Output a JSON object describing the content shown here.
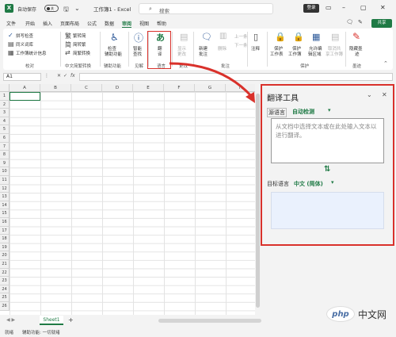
{
  "titlebar": {
    "logo": "X",
    "autosave_label": "自动保存",
    "autosave_state": "关",
    "doc_title": "工作簿1 - Excel",
    "search_placeholder": "搜索",
    "login": "登录"
  },
  "tabs": {
    "items": [
      "文件",
      "开始",
      "插入",
      "页面布局",
      "公式",
      "数据",
      "审阅",
      "视图",
      "帮助"
    ],
    "active_index": 6,
    "share": "共享"
  },
  "ribbon": {
    "spell": "拼写检查",
    "thesaurus": "同义词库",
    "stats": "工作簿统计信息",
    "proofing_group": "校对",
    "to_trad": "繁转简",
    "to_simp": "简转繁",
    "conv": "简繁转换",
    "chinese_group": "中文简繁转换",
    "check_access": [
      "检查",
      "辅助功能"
    ],
    "access_group": "辅助功能",
    "smart_lookup": [
      "智能",
      "查找"
    ],
    "insight_group": "见解",
    "translate": [
      "翻",
      "译"
    ],
    "language_group": "语言",
    "show_changes": [
      "显示",
      "更改"
    ],
    "changes_group": "更改",
    "new_comment": [
      "新建",
      "批注"
    ],
    "delete_comment": "删除",
    "comment_prev": "上一条",
    "comment_next": "下一条",
    "notes": "注释",
    "comments_group": "批注",
    "protect_sheet": [
      "保护",
      "工作表"
    ],
    "protect_wb": [
      "保护",
      "工作簿"
    ],
    "allow_edit": [
      "允许编",
      "辑区域"
    ],
    "unshare": [
      "取消共",
      "享工作簿"
    ],
    "protect_group": "保护",
    "hide_ink": [
      "隐藏墨",
      "迹"
    ],
    "ink_group": "墨迹"
  },
  "formula_bar": {
    "cell_ref": "A1",
    "fx": "fx"
  },
  "grid": {
    "columns": [
      "A",
      "B",
      "C",
      "D",
      "E",
      "F",
      "G",
      "H"
    ],
    "rows": [
      "1",
      "2",
      "3",
      "4",
      "5",
      "6",
      "7",
      "8",
      "9",
      "10",
      "11",
      "12",
      "13",
      "14",
      "15",
      "16",
      "17",
      "18",
      "19",
      "20",
      "21",
      "22",
      "23",
      "24",
      "25",
      "26"
    ]
  },
  "sheetbar": {
    "sheet_name": "Sheet1",
    "add": "+"
  },
  "status": {
    "ready": "就绪",
    "accessibility": "辅助功能: 一切就绪"
  },
  "pane": {
    "title": "翻译工具",
    "source_label": "源语言",
    "source_value": "自动检测",
    "source_placeholder": "从文档中选择文本或在此处输入文本以进行翻译。",
    "swap": "⇅",
    "target_label": "目标语言",
    "target_value": "中文 (简体)"
  },
  "watermark": {
    "badge": "php",
    "text": "中文网"
  },
  "colors": {
    "accent": "#1f7a45",
    "highlight": "#d9312b"
  }
}
